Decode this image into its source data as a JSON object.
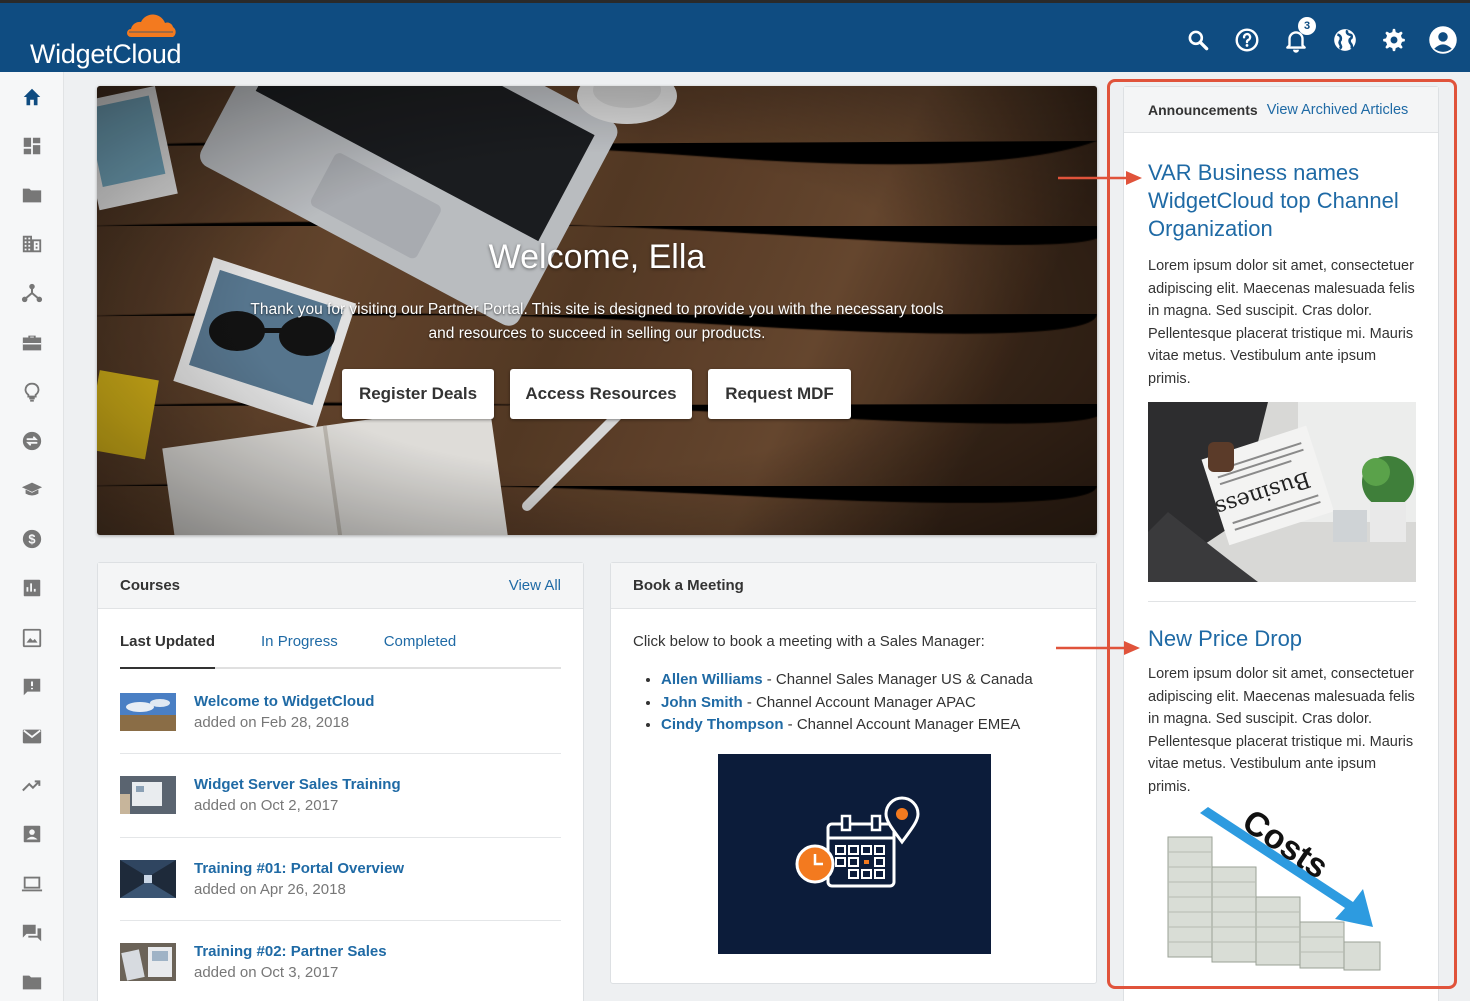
{
  "brand": {
    "name": "WidgetCloud",
    "primary_color": "#0f4c81",
    "accent_color": "#f37a1f",
    "link_color": "#1f6aa5"
  },
  "topbar": {
    "icons": [
      "search-icon",
      "help-icon",
      "bell-icon",
      "globe-icon",
      "gear-icon",
      "account-icon"
    ],
    "notification_count": "3"
  },
  "sidebar": {
    "items": [
      "home-icon",
      "dashboard-icon",
      "folder-icon",
      "building-icon",
      "hierarchy-icon",
      "briefcase-icon",
      "lightbulb-icon",
      "swap-icon",
      "graduation-cap-icon",
      "dollar-icon",
      "bar-chart-icon",
      "image-icon",
      "feedback-icon",
      "mail-icon",
      "trending-up-icon",
      "contact-card-icon",
      "laptop-icon",
      "chat-icon",
      "folder-icon"
    ]
  },
  "hero": {
    "title": "Welcome, Ella",
    "subtitle": "Thank you for visiting our Partner Portal. This site is designed to provide you with the necessary tools and resources to succeed in selling our products.",
    "buttons": [
      {
        "label": "Register Deals"
      },
      {
        "label": "Access Resources"
      },
      {
        "label": "Request MDF"
      }
    ]
  },
  "courses": {
    "title": "Courses",
    "view_all": "View All",
    "tabs": [
      "Last Updated",
      "In Progress",
      "Completed"
    ],
    "items": [
      {
        "title": "Welcome to WidgetCloud",
        "date": "added on Feb 28, 2018"
      },
      {
        "title": "Widget Server Sales Training",
        "date": "added on Oct 2, 2017"
      },
      {
        "title": "Training #01: Portal Overview",
        "date": "added on Apr 26, 2018"
      },
      {
        "title": "Training #02: Partner Sales",
        "date": "added on Oct 3, 2017"
      }
    ]
  },
  "meeting": {
    "title": "Book a Meeting",
    "intro": "Click below to book a meeting with a Sales Manager:",
    "managers": [
      {
        "name": "Allen Williams",
        "role": " - Channel Sales Manager US & Canada"
      },
      {
        "name": "John Smith",
        "role": " - Channel Account Manager APAC"
      },
      {
        "name": "Cindy Thompson",
        "role": " - Channel Account Manager EMEA"
      }
    ]
  },
  "announcements": {
    "title": "Announcements",
    "archive_link": "View Archived Articles",
    "articles": [
      {
        "title": "VAR Business names WidgetCloud top Channel Organization",
        "body": "Lorem ipsum dolor sit amet, consectetuer adipiscing elit. Maecenas malesuada felis in magna. Sed suscipit. Cras dolor. Pellentesque placerat tristique mi. Mauris vitae metus. Vestibulum ante ipsum primis.",
        "image_text": "Business"
      },
      {
        "title": "New Price Drop",
        "body": "Lorem ipsum dolor sit amet, consectetuer adipiscing elit. Maecenas malesuada felis in magna. Sed suscipit. Cras dolor. Pellentesque placerat tristique mi. Mauris vitae metus. Vestibulum ante ipsum primis.",
        "image_text": "Costs"
      }
    ]
  },
  "annotation_color": "#e0533b"
}
